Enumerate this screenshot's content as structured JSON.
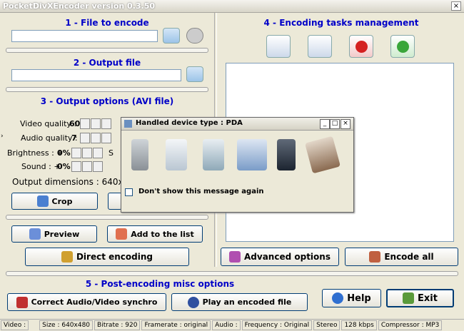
{
  "window": {
    "title": "PocketDivXEncoder version 0.3.50",
    "close": "×"
  },
  "left": {
    "section1": {
      "title": "1 - File to encode",
      "input_value": ""
    },
    "section2": {
      "title": "2 - Output file",
      "input_value": ""
    },
    "section3": {
      "title": "3 - Output options (AVI file)",
      "video_quality_label": "Video quality :",
      "video_quality_value": "60",
      "audio_quality_label": "Audio quality :",
      "audio_quality_value": "7",
      "brightness_label": "Brightness : +",
      "brightness_value": "0%",
      "sound_label": "Sound : +",
      "sound_value": "0%",
      "output_dimensions": "Output dimensions : 640x",
      "s_partial": "S",
      "crop_label": "Crop"
    },
    "buttons": {
      "preview": "Preview",
      "add_to_list": "Add to the list",
      "direct_encoding": "Direct encoding"
    }
  },
  "right": {
    "section4": {
      "title": "4 - Encoding tasks management"
    },
    "buttons": {
      "advanced_options": "Advanced options",
      "encode_all": "Encode all"
    }
  },
  "bottom": {
    "section5": {
      "title": "5 - Post-encoding misc options"
    },
    "correct_av": "Correct Audio/Video synchro",
    "play_encoded": "Play an encoded file",
    "help": "Help",
    "exit": "Exit"
  },
  "dialog": {
    "title": "Handled device type : PDA",
    "minimize": "_",
    "maximize": "□",
    "close": "×",
    "checkbox_label": "Don't show this message again",
    "devices": [
      "phone-device-icon",
      "pda-device-icon",
      "handheld-device-icon",
      "monitor-device-icon",
      "smartphone-device-icon",
      "media-player-device-icon"
    ]
  },
  "status": {
    "video": "Video :",
    "size": "Size : 640x480",
    "bitrate": "Bitrate : 920",
    "framerate": "Framerate : original",
    "audio": "Audio :",
    "frequency": "Frequency : Original",
    "stereo": "Stereo",
    "kbps": "128 kbps",
    "compressor": "Compressor : MP3"
  },
  "colors": {
    "heading": "#0000c8",
    "window_bg": "#ece9d8",
    "button_border": "#003c74"
  }
}
